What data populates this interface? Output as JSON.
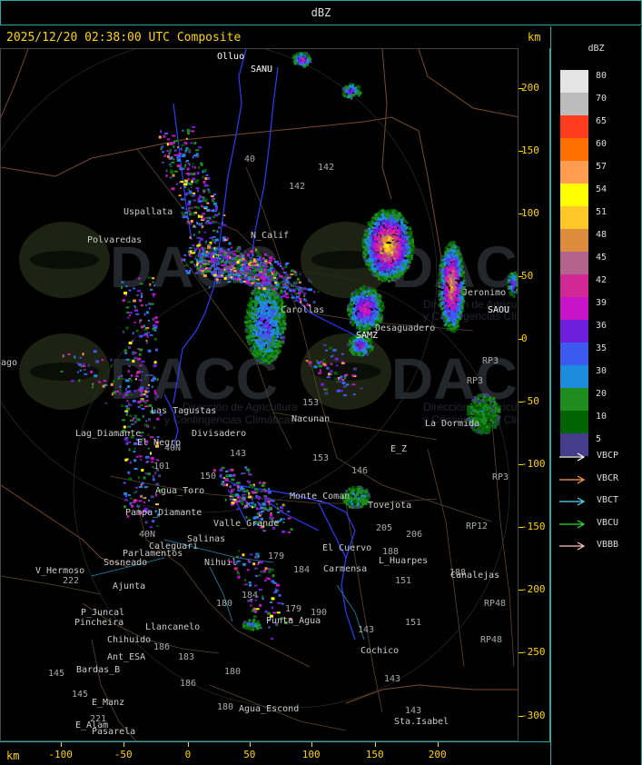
{
  "top_bar": {
    "title": "dBZ"
  },
  "header": {
    "timestamp": "2025/12/20 02:38:00 UTC Composite",
    "km_label": "km"
  },
  "legend": {
    "title": "dBZ",
    "scale": [
      {
        "label": "80",
        "color": "#e4e4e4"
      },
      {
        "label": "70",
        "color": "#bcbcbc"
      },
      {
        "label": "65",
        "color": "#ff3c1e"
      },
      {
        "label": "60",
        "color": "#ff6e00"
      },
      {
        "label": "57",
        "color": "#ff9c50"
      },
      {
        "label": "54",
        "color": "#ffff00"
      },
      {
        "label": "51",
        "color": "#ffc828"
      },
      {
        "label": "48",
        "color": "#dc8c3c"
      },
      {
        "label": "45",
        "color": "#b4648c"
      },
      {
        "label": "42",
        "color": "#d22896"
      },
      {
        "label": "39",
        "color": "#c814c8"
      },
      {
        "label": "36",
        "color": "#6e1edc"
      },
      {
        "label": "35",
        "color": "#3c5af0"
      },
      {
        "label": "30",
        "color": "#1e8cdc"
      },
      {
        "label": "20",
        "color": "#1e8c1e"
      },
      {
        "label": "10",
        "color": "#006400"
      },
      {
        "label": "5",
        "color": "#463c8c"
      }
    ],
    "radars": [
      {
        "label": "VBCP",
        "color": "#ffffff"
      },
      {
        "label": "VBCR",
        "color": "#ffa050"
      },
      {
        "label": "VBCT",
        "color": "#50dcff"
      },
      {
        "label": "VBCU",
        "color": "#32dc32"
      },
      {
        "label": "VBBB",
        "color": "#ffc8c8"
      }
    ]
  },
  "axes": {
    "km_bottom": "km",
    "x_ticks": [
      "-100",
      "-50",
      "0",
      "50",
      "100",
      "150",
      "200"
    ],
    "y_ticks": [
      "200",
      "150",
      "100",
      "50",
      "0",
      "-50",
      "-100",
      "-150",
      "-200",
      "-250",
      "-300"
    ]
  },
  "map": {
    "watermark": {
      "logo_text": "DACC",
      "subtitle_1": "Dirección de Agricultura",
      "subtitle_2": "y Contingencias Climáticas"
    },
    "places": [
      {
        "name": "Olluo",
        "color": "#ffffff"
      },
      {
        "name": "SANU",
        "color": "#ffffff"
      },
      {
        "name": "40",
        "color": "#aaaaaa"
      },
      {
        "name": "142",
        "color": "#aaaaaa"
      },
      {
        "name": "142",
        "color": "#aaaaaa"
      },
      {
        "name": "Uspallata",
        "color": "#cccccc"
      },
      {
        "name": "Polvaredas",
        "color": "#cccccc"
      },
      {
        "name": "N_Calif",
        "color": "#cccccc"
      },
      {
        "name": "Carollas",
        "color": "#cccccc"
      },
      {
        "name": "Jeronimo",
        "color": "#cccccc"
      },
      {
        "name": "SAOU",
        "color": "#ffffff"
      },
      {
        "name": "Desaguadero",
        "color": "#cccccc"
      },
      {
        "name": "SAMZ",
        "color": "#ffffff"
      },
      {
        "name": "RP3",
        "color": "#aaaaaa"
      },
      {
        "name": "RP3",
        "color": "#aaaaaa"
      },
      {
        "name": "RP3",
        "color": "#aaaaaa"
      },
      {
        "name": "153",
        "color": "#aaaaaa"
      },
      {
        "name": "Nacunan",
        "color": "#cccccc"
      },
      {
        "name": "La Dormida",
        "color": "#cccccc"
      },
      {
        "name": "Las Tagustas",
        "color": "#cccccc"
      },
      {
        "name": "Lag_Diamante",
        "color": "#cccccc"
      },
      {
        "name": "Divisadero",
        "color": "#cccccc"
      },
      {
        "name": "El Negro",
        "color": "#cccccc"
      },
      {
        "name": "40N",
        "color": "#aaaaaa"
      },
      {
        "name": "143",
        "color": "#aaaaaa"
      },
      {
        "name": "101",
        "color": "#aaaaaa"
      },
      {
        "name": "153",
        "color": "#aaaaaa"
      },
      {
        "name": "E_Z",
        "color": "#cccccc"
      },
      {
        "name": "146",
        "color": "#aaaaaa"
      },
      {
        "name": "150",
        "color": "#aaaaaa"
      },
      {
        "name": "Agua_Toro",
        "color": "#cccccc"
      },
      {
        "name": "Pampa_Diamante",
        "color": "#cccccc"
      },
      {
        "name": "Salinas",
        "color": "#cccccc"
      },
      {
        "name": "Valle_Grande",
        "color": "#cccccc"
      },
      {
        "name": "Monte_Coman",
        "color": "#cccccc"
      },
      {
        "name": "Tovejota",
        "color": "#cccccc"
      },
      {
        "name": "205",
        "color": "#aaaaaa"
      },
      {
        "name": "206",
        "color": "#aaaaaa"
      },
      {
        "name": "RP12",
        "color": "#aaaaaa"
      },
      {
        "name": "40N",
        "color": "#aaaaaa"
      },
      {
        "name": "Caleguari",
        "color": "#cccccc"
      },
      {
        "name": "Parlamentos",
        "color": "#cccccc"
      },
      {
        "name": "Sosneado",
        "color": "#cccccc"
      },
      {
        "name": "Nihuil",
        "color": "#cccccc"
      },
      {
        "name": "179",
        "color": "#aaaaaa"
      },
      {
        "name": "184",
        "color": "#aaaaaa"
      },
      {
        "name": "El Cuervo",
        "color": "#cccccc"
      },
      {
        "name": "Carmensa",
        "color": "#cccccc"
      },
      {
        "name": "188",
        "color": "#aaaaaa"
      },
      {
        "name": "L_Huarpes",
        "color": "#cccccc"
      },
      {
        "name": "151",
        "color": "#aaaaaa"
      },
      {
        "name": "188",
        "color": "#aaaaaa"
      },
      {
        "name": "Canalejas",
        "color": "#cccccc"
      },
      {
        "name": "V_Hermoso",
        "color": "#cccccc"
      },
      {
        "name": "222",
        "color": "#aaaaaa"
      },
      {
        "name": "Ajunta",
        "color": "#cccccc"
      },
      {
        "name": "180",
        "color": "#aaaaaa"
      },
      {
        "name": "184",
        "color": "#aaaaaa"
      },
      {
        "name": "179",
        "color": "#aaaaaa"
      },
      {
        "name": "190",
        "color": "#aaaaaa"
      },
      {
        "name": "RP48",
        "color": "#aaaaaa"
      },
      {
        "name": "P_Juncal",
        "color": "#cccccc"
      },
      {
        "name": "Pincheira",
        "color": "#cccccc"
      },
      {
        "name": "Llancanelo",
        "color": "#cccccc"
      },
      {
        "name": "Punta_Agua",
        "color": "#cccccc"
      },
      {
        "name": "143",
        "color": "#aaaaaa"
      },
      {
        "name": "151",
        "color": "#aaaaaa"
      },
      {
        "name": "RP48",
        "color": "#aaaaaa"
      },
      {
        "name": "Chihuido",
        "color": "#cccccc"
      },
      {
        "name": "186",
        "color": "#aaaaaa"
      },
      {
        "name": "Ant_ESA",
        "color": "#cccccc"
      },
      {
        "name": "183",
        "color": "#aaaaaa"
      },
      {
        "name": "Cochico",
        "color": "#cccccc"
      },
      {
        "name": "145",
        "color": "#aaaaaa"
      },
      {
        "name": "145",
        "color": "#aaaaaa"
      },
      {
        "name": "Bardas_B",
        "color": "#cccccc"
      },
      {
        "name": "180",
        "color": "#aaaaaa"
      },
      {
        "name": "186",
        "color": "#aaaaaa"
      },
      {
        "name": "143",
        "color": "#aaaaaa"
      },
      {
        "name": "E_Manz",
        "color": "#cccccc"
      },
      {
        "name": "180",
        "color": "#aaaaaa"
      },
      {
        "name": "Agua_Escond",
        "color": "#cccccc"
      },
      {
        "name": "221",
        "color": "#aaaaaa"
      },
      {
        "name": "E_Alam",
        "color": "#cccccc"
      },
      {
        "name": "143",
        "color": "#aaaaaa"
      },
      {
        "name": "Sta.Isabel",
        "color": "#cccccc"
      },
      {
        "name": "Pasarela",
        "color": "#cccccc"
      },
      {
        "name": "ago",
        "color": "#cccccc"
      }
    ]
  }
}
